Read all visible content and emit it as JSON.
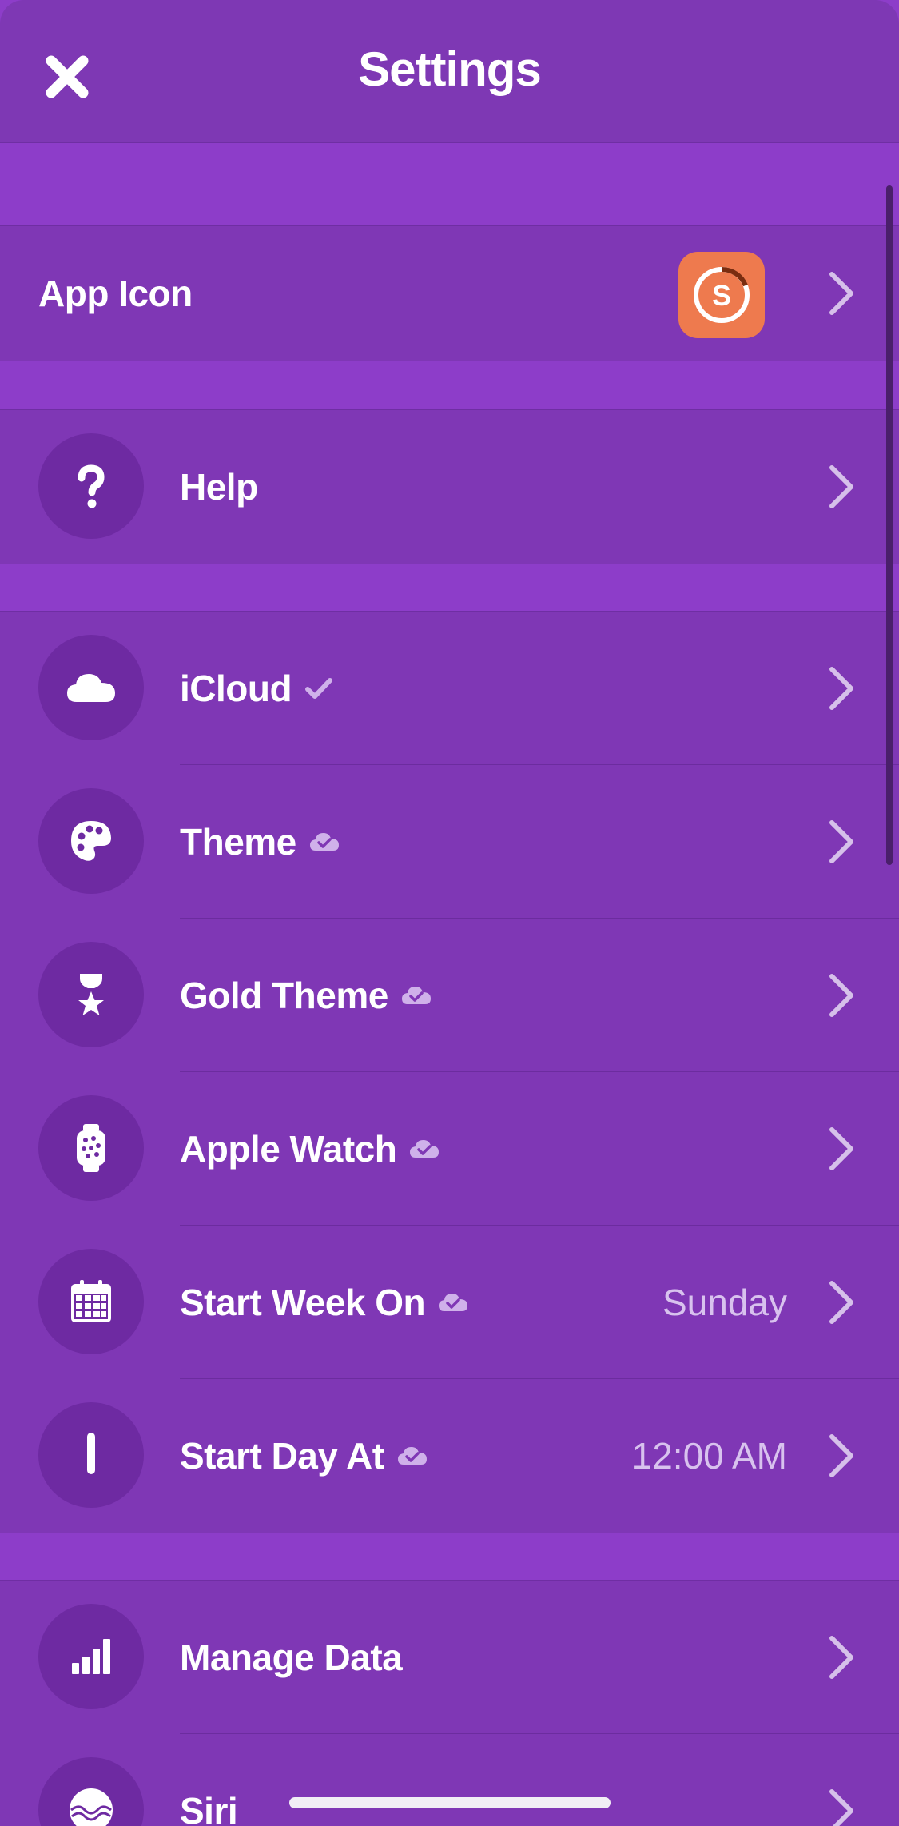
{
  "nav": {
    "title": "Settings",
    "close_icon": "close-icon"
  },
  "app_icon_row": {
    "label": "App Icon",
    "icon_letter": "S",
    "icon_color": "#ee7a4e"
  },
  "help_row": {
    "label": "Help",
    "icon": "question-icon"
  },
  "sync_rows": [
    {
      "label": "iCloud",
      "badge": "check-icon",
      "value": "",
      "icon": "cloud-icon"
    },
    {
      "label": "Theme",
      "badge": "cloud-check-icon",
      "value": "",
      "icon": "palette-icon"
    },
    {
      "label": "Gold Theme",
      "badge": "cloud-check-icon",
      "value": "",
      "icon": "trophy-icon"
    },
    {
      "label": "Apple Watch",
      "badge": "cloud-check-icon",
      "value": "",
      "icon": "watch-icon"
    },
    {
      "label": "Start Week On",
      "badge": "cloud-check-icon",
      "value": "Sunday",
      "icon": "calendar-icon"
    },
    {
      "label": "Start Day At",
      "badge": "cloud-check-icon",
      "value": "12:00 AM",
      "icon": "clock-hand-icon"
    }
  ],
  "data_rows": [
    {
      "label": "Manage Data",
      "icon": "bar-chart-icon"
    },
    {
      "label": "Siri",
      "icon": "siri-icon"
    }
  ],
  "colors": {
    "background": "#8d3dc9",
    "row": "#7f37b5",
    "icon_circle": "#6e2aa2",
    "value_text": "#d8c2ee"
  }
}
